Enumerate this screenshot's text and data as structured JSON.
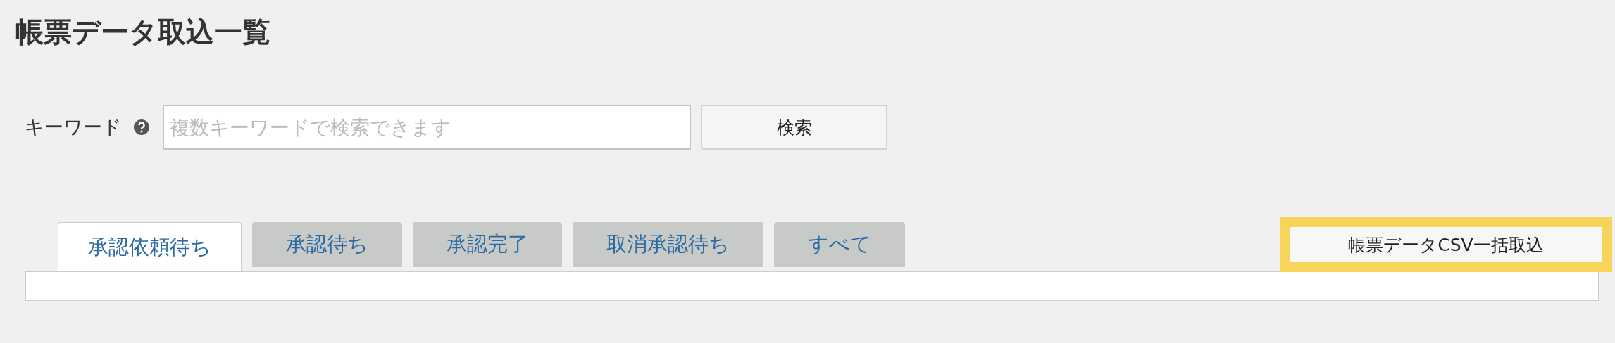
{
  "page_title": "帳票データ取込一覧",
  "search": {
    "label": "キーワード",
    "help_icon": true,
    "placeholder": "複数キーワードで検索できます",
    "button": "検索"
  },
  "tabs": [
    {
      "label": "承認依頼待ち",
      "selected": true
    },
    {
      "label": "承認待ち",
      "selected": false
    },
    {
      "label": "承認完了",
      "selected": false
    },
    {
      "label": "取消承認待ち",
      "selected": false
    },
    {
      "label": "すべて",
      "selected": false
    }
  ],
  "import_button": {
    "label": "帳票データCSV一括取込",
    "highlighted": true
  }
}
